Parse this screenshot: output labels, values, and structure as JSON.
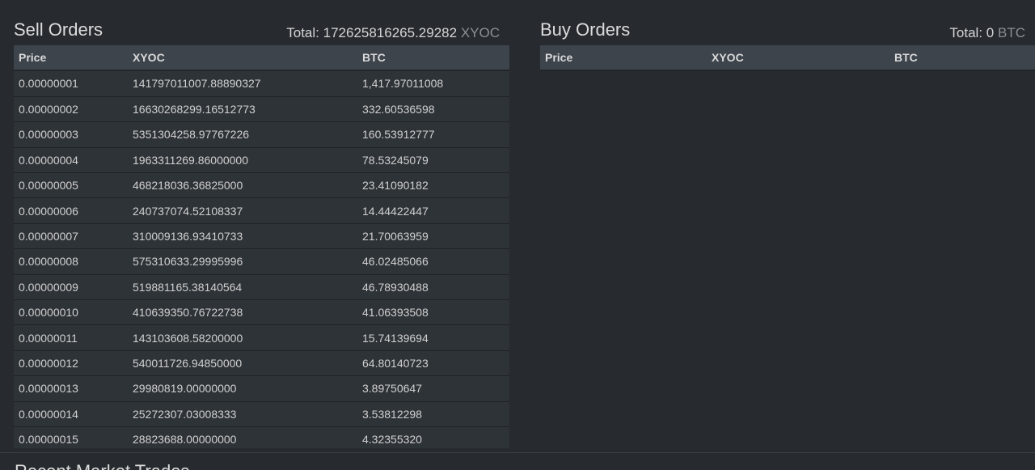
{
  "sell_orders": {
    "title": "Sell Orders",
    "total_label": "Total:",
    "total_value": "172625816265.29282",
    "total_unit": "XYOC",
    "columns": [
      "Price",
      "XYOC",
      "BTC"
    ],
    "rows": [
      {
        "price": "0.00000001",
        "xyoc": "141797011007.88890327",
        "btc": "1,417.97011008"
      },
      {
        "price": "0.00000002",
        "xyoc": "16630268299.16512773",
        "btc": "332.60536598"
      },
      {
        "price": "0.00000003",
        "xyoc": "5351304258.97767226",
        "btc": "160.53912777"
      },
      {
        "price": "0.00000004",
        "xyoc": "1963311269.86000000",
        "btc": "78.53245079"
      },
      {
        "price": "0.00000005",
        "xyoc": "468218036.36825000",
        "btc": "23.41090182"
      },
      {
        "price": "0.00000006",
        "xyoc": "240737074.52108337",
        "btc": "14.44422447"
      },
      {
        "price": "0.00000007",
        "xyoc": "310009136.93410733",
        "btc": "21.70063959"
      },
      {
        "price": "0.00000008",
        "xyoc": "575310633.29995996",
        "btc": "46.02485066"
      },
      {
        "price": "0.00000009",
        "xyoc": "519881165.38140564",
        "btc": "46.78930488"
      },
      {
        "price": "0.00000010",
        "xyoc": "410639350.76722738",
        "btc": "41.06393508"
      },
      {
        "price": "0.00000011",
        "xyoc": "143103608.58200000",
        "btc": "15.74139694"
      },
      {
        "price": "0.00000012",
        "xyoc": "540011726.94850000",
        "btc": "64.80140723"
      },
      {
        "price": "0.00000013",
        "xyoc": "29980819.00000000",
        "btc": "3.89750647"
      },
      {
        "price": "0.00000014",
        "xyoc": "25272307.03008333",
        "btc": "3.53812298"
      },
      {
        "price": "0.00000015",
        "xyoc": "28823688.00000000",
        "btc": "4.32355320"
      }
    ]
  },
  "buy_orders": {
    "title": "Buy Orders",
    "total_label": "Total:",
    "total_value": "0",
    "total_unit": "BTC",
    "columns": [
      "Price",
      "XYOC",
      "BTC"
    ],
    "rows": []
  },
  "recent_trades": {
    "title": "Recent Market Trades"
  }
}
